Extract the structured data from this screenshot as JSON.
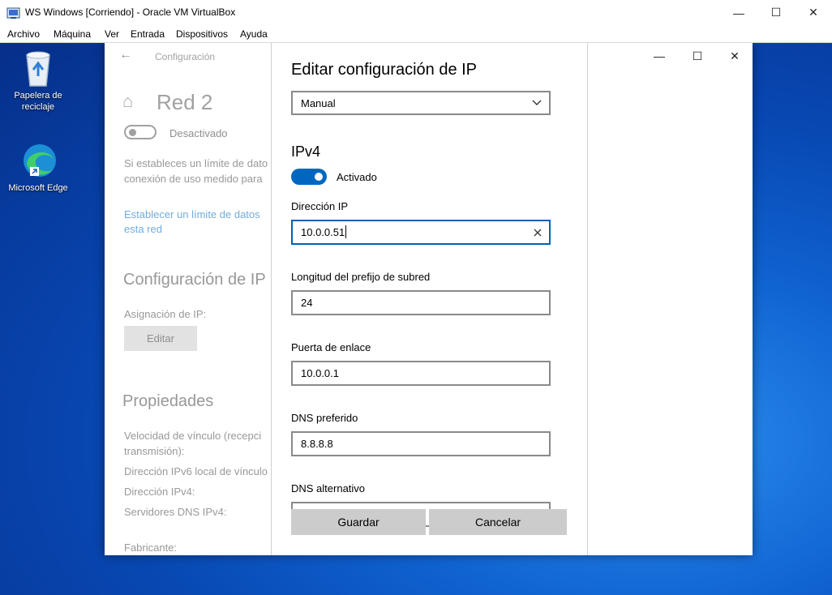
{
  "vbox": {
    "title": "WS Windows [Corriendo] - Oracle VM VirtualBox",
    "minimize_icon": "—",
    "maximize_icon": "☐",
    "close_icon": "✕",
    "menu": [
      "Archivo",
      "Máquina",
      "Ver",
      "Entrada",
      "Dispositivos",
      "Ayuda"
    ]
  },
  "desktop": {
    "icons": [
      {
        "label_line1": "Papelera de",
        "label_line2": "reciclaje",
        "icon": "recycle-bin-icon"
      },
      {
        "label_line1": "Microsoft Edge",
        "label_line2": "",
        "icon": "edge-icon"
      }
    ]
  },
  "settings_window": {
    "back_icon": "←",
    "breadcrumb": "Configuración",
    "minimize_icon": "—",
    "maximize_icon": "☐",
    "close_icon": "✕",
    "home_icon": "⌂",
    "network_name": "Red 2",
    "metered_toggle_label": "Desactivado",
    "metered_desc_line1": "Si estableces un límite de dato",
    "metered_desc_line2": "conexión de uso medido para",
    "data_limit_link_line1": "Establecer un límite de datos",
    "data_limit_link_line2": "esta red",
    "ip_settings_heading": "Configuración de IP",
    "ip_assignment_label": "Asignación de IP:",
    "edit_button": "Editar",
    "properties_heading": "Propiedades",
    "properties": [
      "Velocidad de vínculo (recepci",
      "transmisión):",
      "Dirección IPv6 local de vínculo",
      "Dirección IPv4:",
      "Servidores DNS IPv4:",
      "Fabricante:"
    ]
  },
  "dialog": {
    "title": "Editar configuración de IP",
    "mode_select": "Manual",
    "chevron_icon": "⌄",
    "ipv4_heading": "IPv4",
    "ipv4_toggle_label": "Activado",
    "ipv4_enabled": true,
    "ip_label": "Dirección IP",
    "ip_value": "10.0.0.51",
    "clear_icon": "✕",
    "prefix_label": "Longitud del prefijo de subred",
    "prefix_value": "24",
    "gateway_label": "Puerta de enlace",
    "gateway_value": "10.0.0.1",
    "dns_pref_label": "DNS preferido",
    "dns_pref_value": "8.8.8.8",
    "dns_alt_label": "DNS alternativo",
    "dns_alt_value": "",
    "save_button": "Guardar",
    "cancel_button": "Cancelar"
  }
}
